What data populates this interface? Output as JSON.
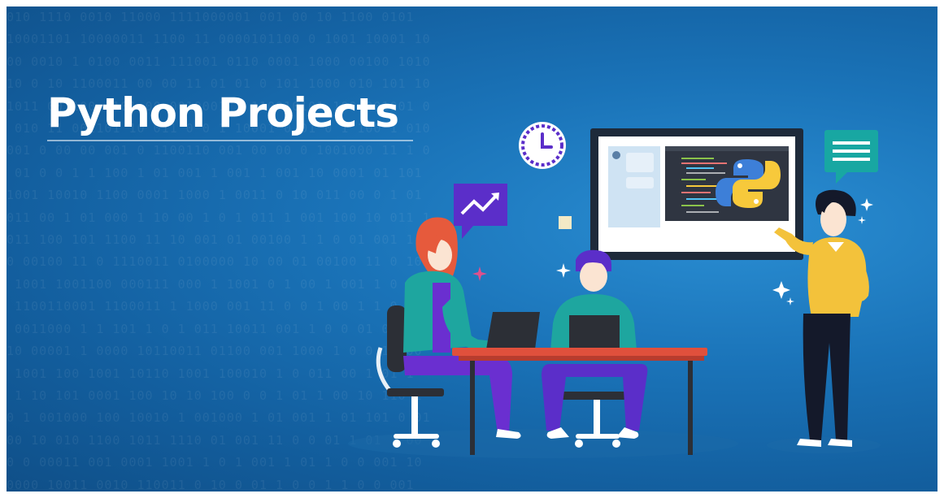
{
  "banner": {
    "title": "Python Projects",
    "colors": {
      "background": "#1a73b8",
      "title": "#ffffff",
      "accent_purple": "#5b2ec9",
      "accent_teal": "#18a7a2",
      "table_top": "#e0503c",
      "python_blue": "#3d7fd8",
      "python_yellow": "#f7c93b"
    }
  },
  "illustration": {
    "icons": [
      "clock-icon",
      "trend-chart-icon",
      "chat-bubble-icon",
      "python-logo-icon",
      "sparkle-icon",
      "sticky-note-icon"
    ],
    "figures": [
      "woman-with-laptop",
      "man-with-laptop",
      "presenter-man"
    ]
  }
}
